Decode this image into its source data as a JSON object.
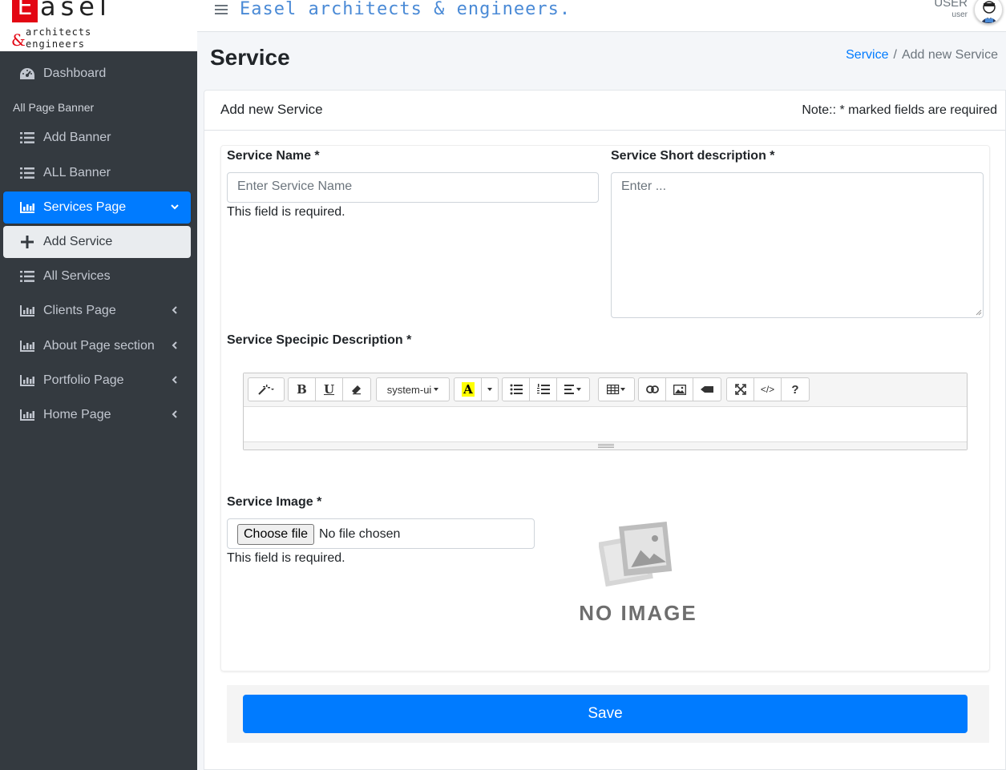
{
  "brand": {
    "letter": "E",
    "rest": "asel",
    "amp": "&",
    "sub1": "architects",
    "sub2": "engineers"
  },
  "header": {
    "title": "Easel architects & engineers.",
    "user_name": "USER",
    "user_role": "user"
  },
  "sidebar": {
    "items": [
      {
        "label": "Dashboard",
        "icon": "dashboard-icon"
      },
      {
        "label": "All Page Banner",
        "type": "header"
      },
      {
        "label": "Add Banner",
        "icon": "list-icon"
      },
      {
        "label": "ALL Banner",
        "icon": "list-icon"
      },
      {
        "label": "Services Page",
        "icon": "chart-icon",
        "active": true
      },
      {
        "label": "Add Service",
        "icon": "plus-icon",
        "sub_active": true
      },
      {
        "label": "All Services",
        "icon": "list-icon"
      },
      {
        "label": "Clients Page",
        "icon": "chart-icon"
      },
      {
        "label": "About Page section",
        "icon": "chart-icon"
      },
      {
        "label": "Portfolio Page",
        "icon": "chart-icon"
      },
      {
        "label": "Home Page",
        "icon": "chart-icon"
      }
    ]
  },
  "page": {
    "title": "Service",
    "breadcrumb": {
      "link": "Service",
      "sep": "/",
      "current": "Add new Service"
    }
  },
  "card": {
    "title": "Add new Service",
    "note": "Note:: * marked fields are required"
  },
  "form": {
    "service_name_label": "Service Name *",
    "service_name_placeholder": "Enter Service Name",
    "service_name_error": "This field is required.",
    "short_desc_label": "Service Short description *",
    "short_desc_placeholder": "Enter ...",
    "specific_desc_label": "Service Specipic Description *",
    "image_label": "Service Image *",
    "choose_file": "Choose file",
    "no_file": "No file chosen",
    "image_error": "This field is required.",
    "no_image_text": "NO IMAGE",
    "save_label": "Save"
  },
  "editor": {
    "font_name": "system-ui",
    "bold": "B",
    "underline": "U",
    "help": "?",
    "code": "</>"
  },
  "colors": {
    "primary": "#007bff",
    "sidebar_bg": "#343a40",
    "brand_red": "#e30613",
    "header_title": "#4a8ad6"
  }
}
